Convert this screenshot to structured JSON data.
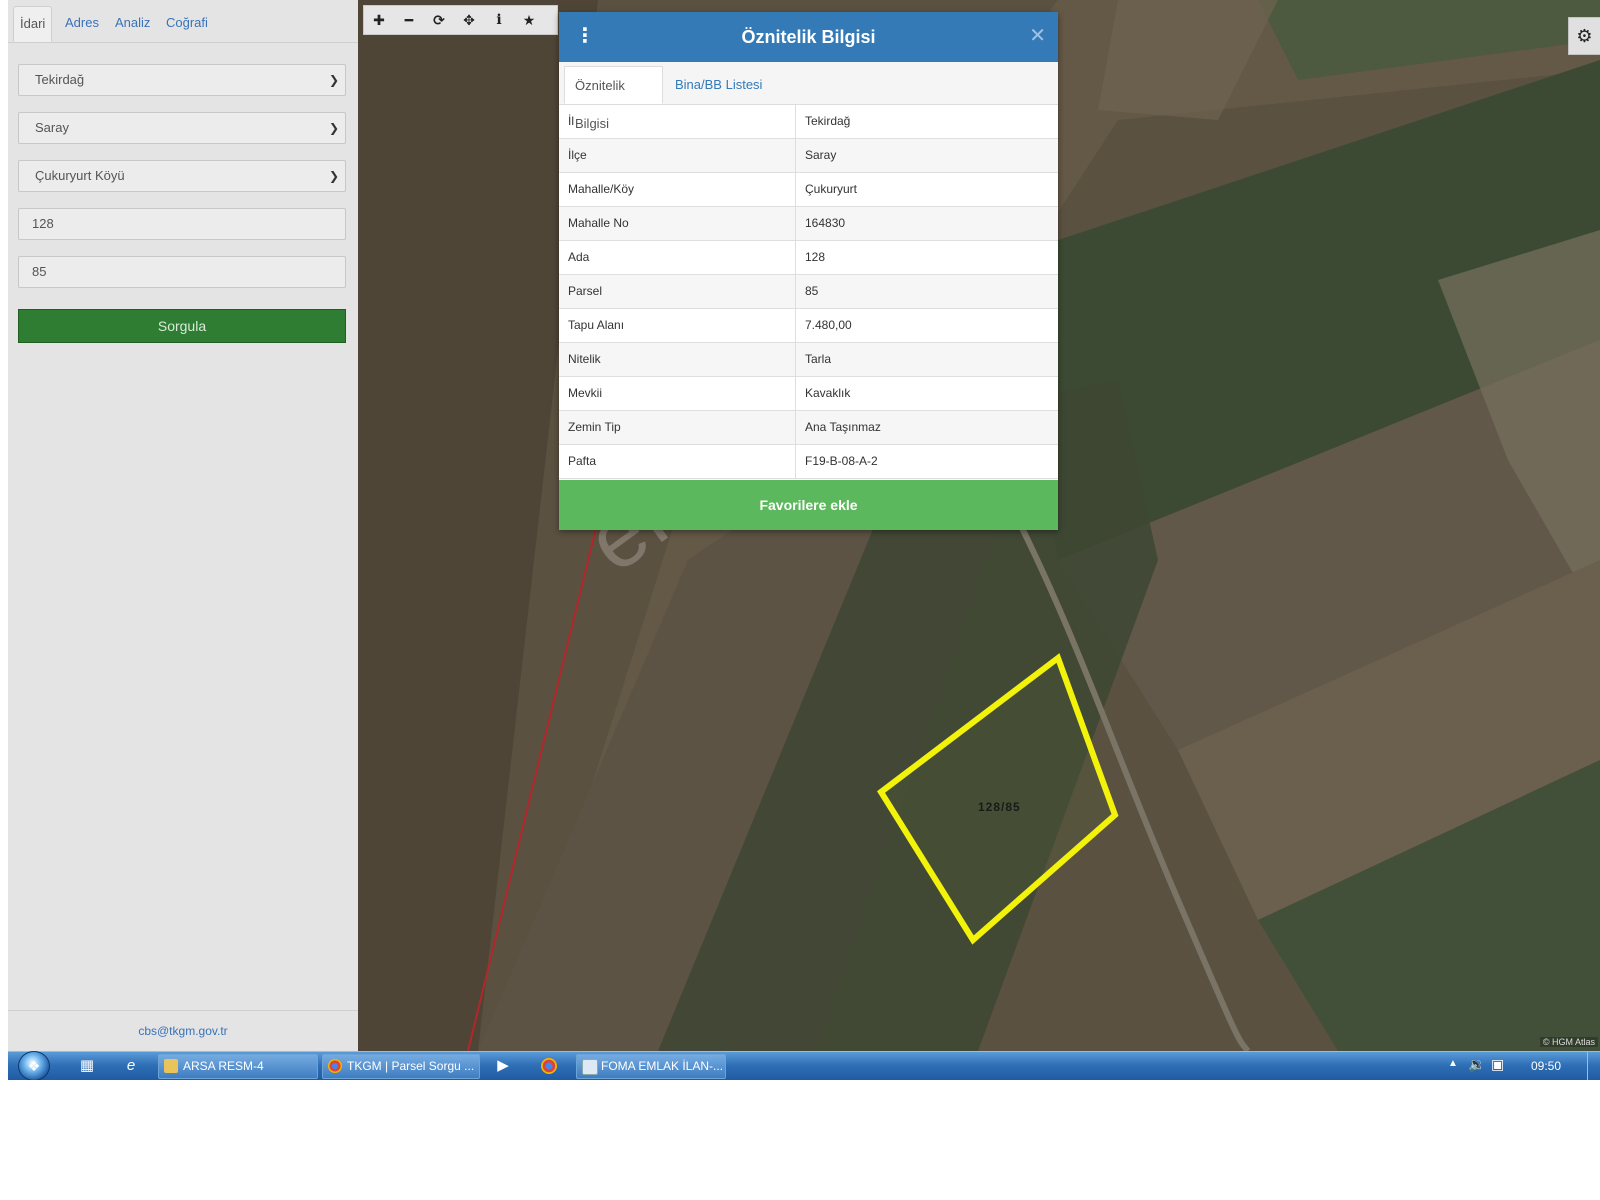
{
  "sidebar": {
    "tabs": [
      "İdari",
      "Adres",
      "Analiz",
      "Coğrafi"
    ],
    "il": "Tekirdağ",
    "ilce": "Saray",
    "mahalle": "Çukuryurt Köyü",
    "ada": "128",
    "parsel": "85",
    "query_label": "Sorgula",
    "footer_email": "cbs@tkgm.gov.tr"
  },
  "map": {
    "toolbar_icons": [
      "plus-icon",
      "minus-icon",
      "refresh-icon",
      "move-icon",
      "info-icon",
      "star-icon"
    ],
    "parcel_label": "128/85",
    "parcel_color": "#f2f20a",
    "attribution": "© HGM Atlas",
    "watermark": "emlakjet.com"
  },
  "dialog": {
    "title": "Öznitelik Bilgisi",
    "header_color": "#337ab7",
    "tabs": [
      "Öznitelik Bilgisi",
      "Bina/BB Listesi"
    ],
    "rows": [
      {
        "key": "İl",
        "value": "Tekirdağ"
      },
      {
        "key": "İlçe",
        "value": "Saray"
      },
      {
        "key": "Mahalle/Köy",
        "value": "Çukuryurt"
      },
      {
        "key": "Mahalle No",
        "value": "164830"
      },
      {
        "key": "Ada",
        "value": "128"
      },
      {
        "key": "Parsel",
        "value": "85"
      },
      {
        "key": "Tapu Alanı",
        "value": "7.480,00"
      },
      {
        "key": "Nitelik",
        "value": "Tarla"
      },
      {
        "key": "Mevkii",
        "value": "Kavaklık"
      },
      {
        "key": "Zemin Tip",
        "value": "Ana Taşınmaz"
      },
      {
        "key": "Pafta",
        "value": "F19-B-08-A-2"
      }
    ],
    "favorite_label": "Favorilere ekle",
    "favorite_color": "#5cb85c"
  },
  "taskbar": {
    "tasks": [
      "ARSA RESM-4",
      "TKGM | Parsel Sorgu ...",
      "FOMA EMLAK İLAN-..."
    ],
    "clock": "09:50"
  }
}
